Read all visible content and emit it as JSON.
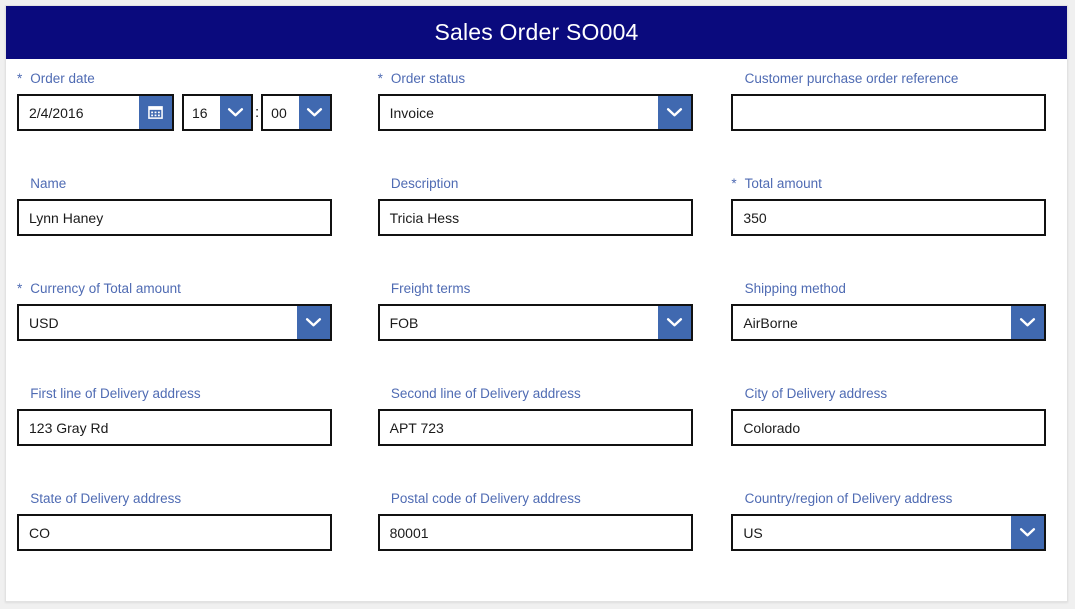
{
  "header": {
    "title": "Sales Order SO004",
    "bg_color": "#0a0a7d",
    "text_color": "#ffffff"
  },
  "theme": {
    "label_color": "#4f6bb3",
    "accent_button_color": "#4069b0",
    "field_border_color": "#111111"
  },
  "form": {
    "rows": [
      {
        "fields": [
          {
            "id": "order-date",
            "label": "Order date",
            "required": true,
            "type": "datetime",
            "date_value": "2/4/2016",
            "hour_value": "16",
            "separator": ":",
            "minute_value": "00",
            "date_icon": "calendar-icon",
            "hour_icon": "chevron-down-icon",
            "minute_icon": "chevron-down-icon"
          },
          {
            "id": "order-status",
            "label": "Order status",
            "required": true,
            "type": "select",
            "value": "Invoice",
            "icon": "chevron-down-icon"
          },
          {
            "id": "customer-purchase-order-reference",
            "label": "Customer purchase order reference",
            "required": false,
            "type": "text",
            "value": ""
          }
        ]
      },
      {
        "fields": [
          {
            "id": "name",
            "label": "Name",
            "required": false,
            "type": "text",
            "value": "Lynn Haney"
          },
          {
            "id": "description",
            "label": "Description",
            "required": false,
            "type": "text",
            "value": "Tricia Hess"
          },
          {
            "id": "total-amount",
            "label": "Total amount",
            "required": true,
            "type": "text",
            "value": "350"
          }
        ]
      },
      {
        "fields": [
          {
            "id": "currency-of-total-amount",
            "label": "Currency of Total amount",
            "required": true,
            "type": "select",
            "value": "USD",
            "icon": "chevron-down-icon"
          },
          {
            "id": "freight-terms",
            "label": "Freight terms",
            "required": false,
            "type": "select",
            "value": "FOB",
            "icon": "chevron-down-icon"
          },
          {
            "id": "shipping-method",
            "label": "Shipping method",
            "required": false,
            "type": "select",
            "value": "AirBorne",
            "icon": "chevron-down-icon"
          }
        ]
      },
      {
        "fields": [
          {
            "id": "first-line-of-delivery-address",
            "label": "First line of Delivery address",
            "required": false,
            "type": "text",
            "value": "123 Gray Rd"
          },
          {
            "id": "second-line-of-delivery-address",
            "label": "Second line of Delivery address",
            "required": false,
            "type": "text",
            "value": "APT 723"
          },
          {
            "id": "city-of-delivery-address",
            "label": "City of Delivery address",
            "required": false,
            "type": "text",
            "value": "Colorado"
          }
        ]
      },
      {
        "fields": [
          {
            "id": "state-of-delivery-address",
            "label": "State of Delivery address",
            "required": false,
            "type": "text",
            "value": "CO"
          },
          {
            "id": "postal-code-of-delivery-address",
            "label": "Postal code of Delivery address",
            "required": false,
            "type": "text",
            "value": "80001"
          },
          {
            "id": "country-region-of-delivery-address",
            "label": "Country/region of Delivery address",
            "required": false,
            "type": "select",
            "value": "US",
            "icon": "chevron-down-icon"
          }
        ]
      }
    ]
  },
  "symbols": {
    "required_marker": "*"
  }
}
